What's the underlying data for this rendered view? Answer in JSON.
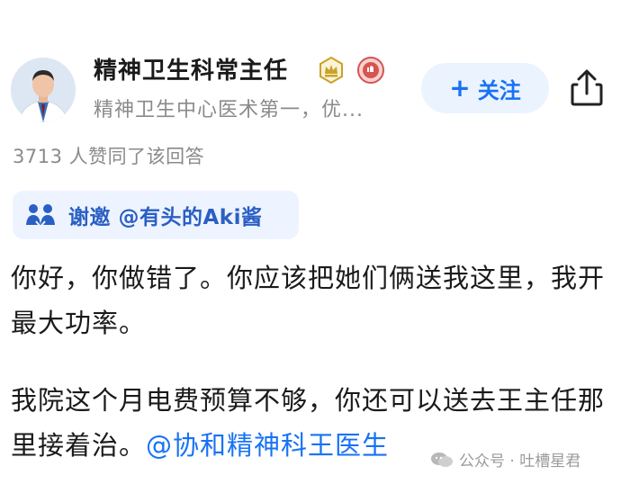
{
  "author": {
    "name": "精神卫生科常主任",
    "description": "精神卫生中心医术第一，优...",
    "follow_label": "关注",
    "follow_plus": "+"
  },
  "stats": {
    "like_text": "3713 人赞同了该回答"
  },
  "invite": {
    "text": "谢邀 @有头的Aki酱"
  },
  "answer": {
    "paragraph1": "你好，你做错了。你应该把她们俩送我这里，我开最大功率。",
    "paragraph2_text": "我院这个月电费预算不够，你还可以送去王主任那里接着治。",
    "paragraph2_mention": "@协和精神科王医生"
  },
  "watermark": {
    "text": "公众号 · 吐槽星君"
  },
  "colors": {
    "accent": "#1772f6",
    "follow_bg": "#ebf3ff",
    "invite_bg": "#eef4ff",
    "invite_text": "#2a5fc4",
    "muted": "#8a8a8a",
    "badge_gold": "#c9a227",
    "badge_red": "#d9534f"
  },
  "icons": {
    "avatar": "doctor-avatar",
    "badge_gold": "crown-badge-icon",
    "badge_red": "red-badge-icon",
    "share": "share-icon",
    "invite": "invite-icon",
    "watermark": "wechat-icon"
  }
}
